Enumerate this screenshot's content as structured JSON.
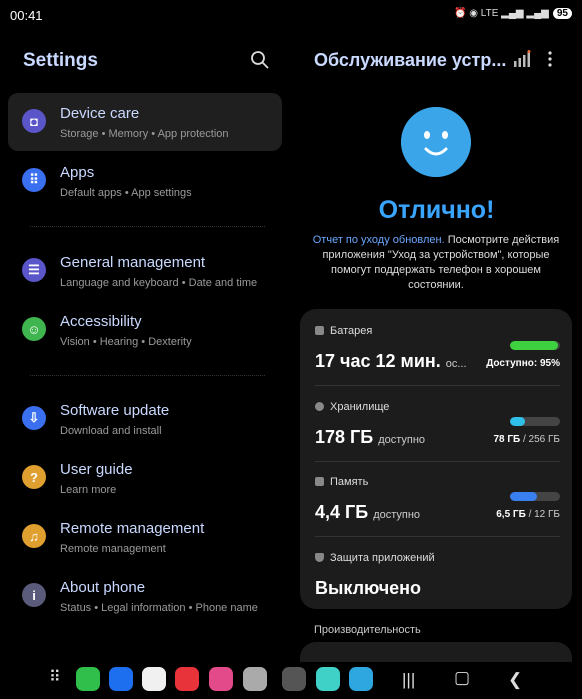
{
  "status": {
    "time": "00:41",
    "icons": "⏰ ◉ LTE ▂▄▆ ▂▄▆",
    "battery": "95"
  },
  "left": {
    "title": "Settings",
    "items": [
      {
        "title": "Device care",
        "subtitle": "Storage  •  Memory  •  App protection",
        "icon": "device-care-icon",
        "color": "#5a55c8"
      },
      {
        "title": "Apps",
        "subtitle": "Default apps  •  App settings",
        "icon": "apps-icon",
        "color": "#3a6ff0"
      },
      {
        "title": "General management",
        "subtitle": "Language and keyboard  •  Date and time",
        "icon": "sliders-icon",
        "color": "#5a55c8"
      },
      {
        "title": "Accessibility",
        "subtitle": "Vision  •  Hearing  •  Dexterity",
        "icon": "accessibility-icon",
        "color": "#3fb550"
      },
      {
        "title": "Software update",
        "subtitle": "Download and install",
        "icon": "update-icon",
        "color": "#3a6ff0"
      },
      {
        "title": "User guide",
        "subtitle": "Learn more",
        "icon": "guide-icon",
        "color": "#e0a030"
      },
      {
        "title": "Remote management",
        "subtitle": "Remote management",
        "icon": "headset-icon",
        "color": "#e0a030"
      },
      {
        "title": "About phone",
        "subtitle": "Status  •  Legal information  •  Phone name",
        "icon": "info-icon",
        "color": "#5a5a7a"
      }
    ]
  },
  "right": {
    "title": "Обслуживание устр...",
    "status": "Отлично!",
    "desc_link": "Отчет по уходу обновлен.",
    "desc_rest": " Посмотрите действия приложения \"Уход за устройством\", которые помогут поддержать телефон в хорошем состоянии.",
    "battery": {
      "label": "Батарея",
      "value": "17 час 12 мин.",
      "suffix": "ос...",
      "meta": "Доступно: 95%",
      "fraction": 0.95,
      "color": "#3ed03e"
    },
    "storage": {
      "label": "Хранилище",
      "value": "178 ГБ",
      "suffix": "доступно",
      "used": "78 ГБ",
      "total": "/ 256 ГБ",
      "fraction": 0.3,
      "color": "#2ec0e8"
    },
    "memory": {
      "label": "Память",
      "value": "4,4 ГБ",
      "suffix": "доступно",
      "used": "6,5 ГБ",
      "total": "/ 12 ГБ",
      "fraction": 0.54,
      "color": "#3a7ff0"
    },
    "protection": {
      "label": "Защита приложений",
      "value": "Выключено"
    },
    "performance": "Производительность"
  },
  "dock": {
    "apps": [
      {
        "name": "app-drawer-icon",
        "color": "#000"
      },
      {
        "name": "phone-app-icon",
        "color": "#2fbf4a"
      },
      {
        "name": "messages-app-icon",
        "color": "#1d6ff0"
      },
      {
        "name": "chrome-app-icon",
        "color": "#f0f0f0"
      },
      {
        "name": "notes-app-icon",
        "color": "#e8333a"
      },
      {
        "name": "gallery-app-icon",
        "color": "#e24a8a"
      },
      {
        "name": "camera-app-icon",
        "color": "#aaaaaa"
      },
      {
        "name": "settings-app-icon",
        "color": "#555"
      },
      {
        "name": "olx-app-icon",
        "color": "#3fd0c8"
      },
      {
        "name": "telegram-app-icon",
        "color": "#2ea6e0"
      }
    ]
  }
}
